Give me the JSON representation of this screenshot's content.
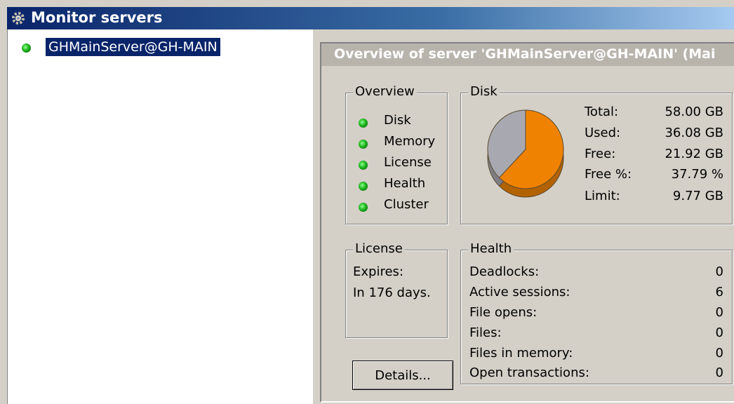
{
  "window": {
    "title": "Monitor servers"
  },
  "tree": {
    "servers": [
      {
        "label": "GHMainServer@GH-MAIN",
        "status": "ok"
      }
    ]
  },
  "overview": {
    "header": "Overview of server 'GHMainServer@GH-MAIN' (Mai",
    "status_group": {
      "legend": "Overview",
      "items": [
        {
          "label": "Disk",
          "status": "ok"
        },
        {
          "label": "Memory",
          "status": "ok"
        },
        {
          "label": "License",
          "status": "ok"
        },
        {
          "label": "Health",
          "status": "ok"
        },
        {
          "label": "Cluster",
          "status": "ok"
        }
      ]
    },
    "disk": {
      "legend": "Disk",
      "rows": [
        {
          "label": "Total:",
          "value": "58.00 GB"
        },
        {
          "label": "Used:",
          "value": "36.08 GB"
        },
        {
          "label": "Free:",
          "value": "21.92 GB"
        },
        {
          "label": "Free %:",
          "value": "37.79 %"
        },
        {
          "label": "Limit:",
          "value": "9.77 GB"
        }
      ],
      "chart": {
        "used_fraction": 0.6221,
        "free_fraction": 0.3779,
        "used_color": "#ef8200",
        "free_color": "#a8a8b0"
      }
    },
    "license": {
      "legend": "License",
      "line1": "Expires:",
      "line2": "In 176 days."
    },
    "health": {
      "legend": "Health",
      "rows": [
        {
          "label": "Deadlocks:",
          "value": "0"
        },
        {
          "label": "Active sessions:",
          "value": "6"
        },
        {
          "label": "File opens:",
          "value": "0"
        },
        {
          "label": "Files:",
          "value": "0"
        },
        {
          "label": "Files in memory:",
          "value": "0"
        },
        {
          "label": "Open transactions:",
          "value": "0"
        }
      ]
    },
    "details_button": {
      "label": "Details..."
    }
  },
  "colors": {
    "status_ok": "#1cb41c",
    "selection": "#0a246a",
    "titlebar": "#0a246a"
  }
}
